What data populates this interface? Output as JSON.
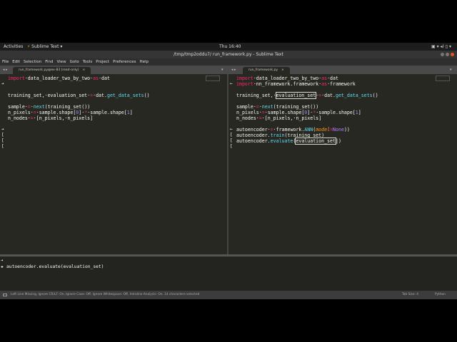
{
  "system": {
    "activities": "Activities",
    "app": "Sublime Text ▾",
    "clock": "Thu 16:40",
    "tray": "▣  ▾ ◂) ▯ ▾"
  },
  "window": {
    "title": "/tmp/tmp2oddu7/ run_framework.py - Sublime Text"
  },
  "menu": [
    "File",
    "Edit",
    "Selection",
    "Find",
    "View",
    "Goto",
    "Tools",
    "Project",
    "Preferences",
    "Help"
  ],
  "tabs": {
    "left": "run_framework.py@ex-83 (read-only)",
    "right": "run_framework.py",
    "close": "×",
    "arrows": "◂ ▸",
    "dropdown": "▾"
  },
  "left_code": [
    {
      "g": "",
      "parts": [
        [
          "k",
          "import"
        ],
        [
          "",
          "·data_loader_two_by_two·"
        ],
        [
          "k",
          "as"
        ],
        [
          "",
          "·dat"
        ]
      ]
    },
    {
      "g": "➔",
      "parts": []
    },
    {
      "g": "",
      "parts": []
    },
    {
      "g": "",
      "parts": [
        [
          "",
          "training_set,·evaluation_set·"
        ],
        [
          "o",
          "="
        ],
        [
          "",
          "·dat."
        ],
        [
          "f",
          "get_data_sets"
        ],
        [
          "",
          "()"
        ]
      ]
    },
    {
      "g": "",
      "parts": []
    },
    {
      "g": "",
      "parts": [
        [
          "",
          "sample·"
        ],
        [
          "o",
          "="
        ],
        [
          "",
          "·"
        ],
        [
          "f",
          "next"
        ],
        [
          "",
          "(training_set())"
        ]
      ]
    },
    {
      "g": "",
      "parts": [
        [
          "",
          "n_pixels·"
        ],
        [
          "o",
          "="
        ],
        [
          "",
          "·sample.shape["
        ],
        [
          "n",
          "0"
        ],
        [
          "",
          "]·"
        ],
        [
          "o",
          "*"
        ],
        [
          "",
          "·sample.shape["
        ],
        [
          "n",
          "1"
        ],
        [
          "",
          "]"
        ]
      ]
    },
    {
      "g": "",
      "parts": [
        [
          "",
          "n_nodes·"
        ],
        [
          "o",
          "="
        ],
        [
          "",
          "·[n_pixels,·n_pixels]"
        ]
      ]
    },
    {
      "g": "",
      "parts": []
    },
    {
      "g": "➔",
      "parts": []
    },
    {
      "g": "[",
      "parts": []
    },
    {
      "g": "[",
      "parts": []
    },
    {
      "g": "[",
      "parts": []
    }
  ],
  "right_code": [
    {
      "g": "",
      "parts": [
        [
          "k",
          "import"
        ],
        [
          "",
          "·data_loader_two_by_two·"
        ],
        [
          "k",
          "as"
        ],
        [
          "",
          "·dat"
        ]
      ]
    },
    {
      "g": "←",
      "parts": [
        [
          "k",
          "import"
        ],
        [
          "",
          "·nn_framework.framework·"
        ],
        [
          "k",
          "as"
        ],
        [
          "",
          "·framework"
        ]
      ]
    },
    {
      "g": "",
      "parts": []
    },
    {
      "g": "",
      "parts": [
        [
          "",
          "training_set,·"
        ],
        [
          "box",
          "evaluation_set"
        ],
        [
          "",
          "·"
        ],
        [
          "o",
          "="
        ],
        [
          "",
          "·dat."
        ],
        [
          "f",
          "get_data_sets"
        ],
        [
          "",
          "()"
        ]
      ]
    },
    {
      "g": "",
      "parts": []
    },
    {
      "g": "",
      "parts": [
        [
          "",
          "sample·"
        ],
        [
          "o",
          "="
        ],
        [
          "",
          "·"
        ],
        [
          "f",
          "next"
        ],
        [
          "",
          "(training_set())"
        ]
      ]
    },
    {
      "g": "",
      "parts": [
        [
          "",
          "n_pixels·"
        ],
        [
          "o",
          "="
        ],
        [
          "",
          "·sample.shape["
        ],
        [
          "n",
          "0"
        ],
        [
          "",
          "]·"
        ],
        [
          "o",
          "*"
        ],
        [
          "",
          "·sample.shape["
        ],
        [
          "n",
          "1"
        ],
        [
          "",
          "]"
        ]
      ]
    },
    {
      "g": "",
      "parts": [
        [
          "",
          "n_nodes·"
        ],
        [
          "o",
          "="
        ],
        [
          "",
          "·[n_pixels,·n_pixels]"
        ]
      ]
    },
    {
      "g": "",
      "parts": []
    },
    {
      "g": "←",
      "parts": [
        [
          "",
          "autoencoder·"
        ],
        [
          "o",
          "="
        ],
        [
          "",
          "·framework."
        ],
        [
          "f",
          "ANN"
        ],
        [
          "",
          "("
        ],
        [
          "p",
          "model"
        ],
        [
          "o",
          "="
        ],
        [
          "n",
          "None"
        ],
        [
          "",
          "))"
        ]
      ]
    },
    {
      "g": "[",
      "parts": [
        [
          "",
          "autoencoder."
        ],
        [
          "f",
          "train"
        ],
        [
          "",
          "(training_set)"
        ]
      ]
    },
    {
      "g": "[",
      "parts": [
        [
          "",
          "autoencoder."
        ],
        [
          "f",
          "evaluate"
        ],
        [
          "",
          "("
        ],
        [
          "box",
          "evaluation_set"
        ],
        [
          "",
          "|)"
        ]
      ]
    },
    {
      "g": "[",
      "parts": []
    }
  ],
  "panel": {
    "lines": [
      {
        "g": "➔",
        "text": ""
      },
      {
        "g": "✚",
        "text": "autoencoder.evaluate(evaluation_set)"
      }
    ]
  },
  "status": {
    "message": "Left Line Missing, Ignore CR/LF: On, Ignore Case: Off, Ignore Whitespace: Off, Intraline Analysis: On, 14 characters selected",
    "tab_size": "Tab Size: 4",
    "syntax": "Python"
  }
}
